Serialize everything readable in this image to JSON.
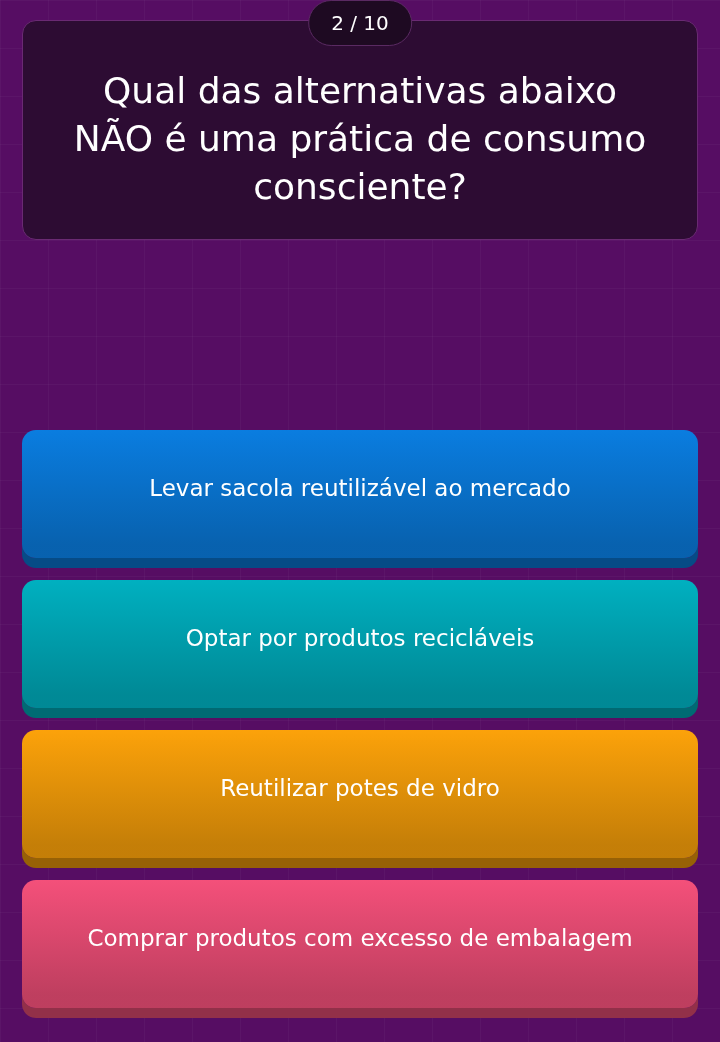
{
  "counter": "2 / 10",
  "question": "Qual das alternativas abaixo NÃO é uma prática de consumo consciente?",
  "answers": [
    {
      "label": "Levar sacola reutilizável ao mercado",
      "color": "#0a7de0"
    },
    {
      "label": "Optar por produtos recicláveis",
      "color": "#00b0c0"
    },
    {
      "label": "Reutilizar potes de vidro",
      "color": "#fca20a"
    },
    {
      "label": "Comprar produtos com excesso de embalagem",
      "color": "#f4507a"
    }
  ]
}
